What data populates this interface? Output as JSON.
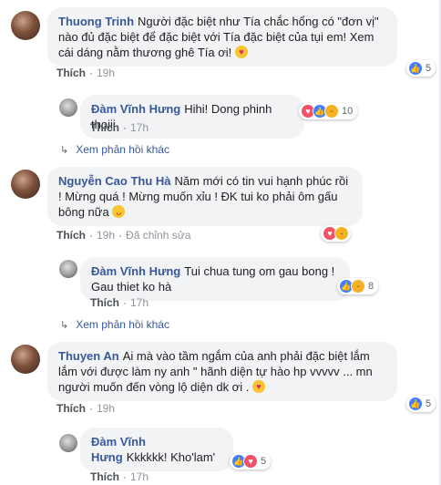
{
  "comments": [
    {
      "author": "Thuong Trinh",
      "text": "Người đặc biệt như Tía chắc hổng có \"đơn vị\" nào đủ đặc biệt để đặc biệt với Tía đặc biệt của tụi em! Xem cái dáng nằm thương ghê Tía ơi!",
      "emoji": "heart-eyes",
      "like_label": "Thích",
      "time": "19h",
      "reactions": [
        "like"
      ],
      "reaction_count": "5",
      "reply": {
        "author": "Đàm Vĩnh Hưng",
        "text": "Hihi! Dong phinh thoiii",
        "like_label": "Thích",
        "time": "17h",
        "reactions": [
          "love",
          "like",
          "haha"
        ],
        "reaction_count": "10"
      },
      "more_replies": "Xem phản hồi khác"
    },
    {
      "author": "Nguyễn Cao Thu Hà",
      "text": "Năm mới có tin vui hạnh phúc rồi ! Mừng quá ! Mừng muốn xỉu ! ĐK tui ko phải ôm gấu bông nữa",
      "emoji": "tongue",
      "like_label": "Thích",
      "time": "19h",
      "edited": "Đã chỉnh sửa",
      "reactions": [
        "love",
        "haha"
      ],
      "reaction_count": "",
      "reply": {
        "author": "Đàm Vĩnh Hưng",
        "text": "Tui chua tung om gau bong ! Gau thiet ko hà",
        "like_label": "Thích",
        "time": "17h",
        "reactions": [
          "like",
          "haha"
        ],
        "reaction_count": "8"
      },
      "more_replies": "Xem phản hồi khác"
    },
    {
      "author": "Thuyen An",
      "text": "Ai mà vào tầm ngắm của anh phải đặc biệt lắm lắm với được làm ny anh \" hãnh diện tự hào hp vvvvv ... mn người muốn đến vòng lộ diện dk ơi .",
      "emoji": "heart-eyes",
      "like_label": "Thích",
      "time": "19h",
      "reactions": [
        "like"
      ],
      "reaction_count": "5",
      "reply": {
        "author": "Đàm Vĩnh Hưng",
        "text": "Kkkkkk! Kho'lam'",
        "like_label": "Thích",
        "time": "17h",
        "reactions": [
          "like",
          "love"
        ],
        "reaction_count": "5"
      }
    }
  ],
  "colors": {
    "author": "#385898",
    "bubble": "#f2f3f5",
    "like": "#4080ff",
    "love": "#f25268",
    "haha": "#f7b125"
  }
}
